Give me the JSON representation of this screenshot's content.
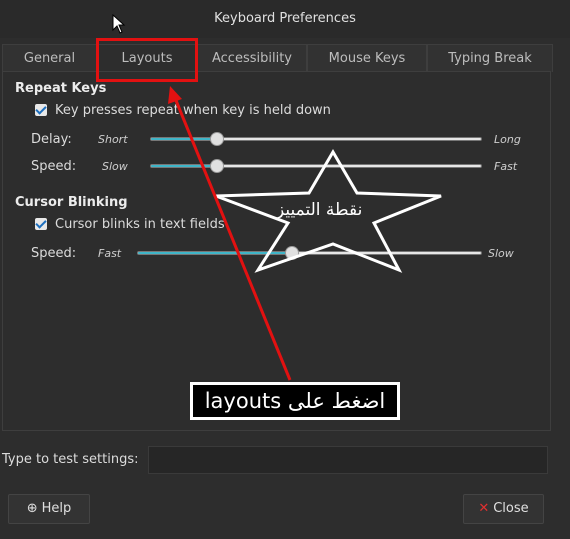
{
  "window": {
    "title": "Keyboard Preferences"
  },
  "tabs": [
    {
      "label": "General"
    },
    {
      "label": "Layouts"
    },
    {
      "label": "Accessibility"
    },
    {
      "label": "Mouse Keys"
    },
    {
      "label": "Typing Break"
    }
  ],
  "repeat_keys": {
    "title": "Repeat Keys",
    "checkbox_label": "Key presses repeat when key is held down",
    "checked": true,
    "delay": {
      "label": "Delay:",
      "min_label": "Short",
      "max_label": "Long",
      "value": 0.2
    },
    "speed": {
      "label": "Speed:",
      "min_label": "Slow",
      "max_label": "Fast",
      "value": 0.2
    }
  },
  "cursor_blinking": {
    "title": "Cursor Blinking",
    "checkbox_label": "Cursor blinks in text fields",
    "checked": true,
    "speed": {
      "label": "Speed:",
      "min_label": "Fast",
      "max_label": "Slow",
      "value": 0.45
    }
  },
  "test": {
    "label": "Type to test settings:",
    "value": ""
  },
  "buttons": {
    "help": "Help",
    "close": "Close"
  },
  "annotations": {
    "star_text": "نقطة التمييز",
    "callout_text": "اضغط على layouts",
    "highlight_color": "#e21111"
  },
  "icons": {
    "help": "help-icon",
    "close": "close-icon",
    "cursor": "mouse-pointer-icon"
  }
}
